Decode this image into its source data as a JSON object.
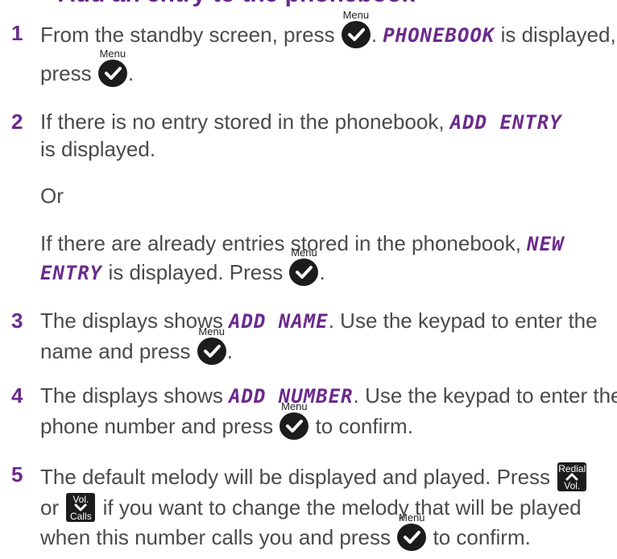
{
  "heading": "Add an entry to the phonebook",
  "menu_key_label": "Menu",
  "redial_key": {
    "top": "Redial",
    "bottom": "Vol."
  },
  "down_key": {
    "top": "Vol.",
    "bottom": "Calls"
  },
  "steps": [
    {
      "number": "1",
      "text_a": "From the standby screen, press",
      "lcd_a": "PHONEBOOK",
      "text_b": "is displayed,",
      "text_c": "press",
      "text_d": "."
    },
    {
      "number": "2",
      "text_a": "If there is no entry stored in the phonebook,",
      "lcd_a": "ADD ENTRY",
      "text_b": "is displayed.",
      "or": "Or",
      "text_c": "If there are already entries stored in the phonebook,",
      "lcd_b": "NEW",
      "lcd_c": "ENTRY",
      "text_d": "is displayed. Press",
      "text_e": "."
    },
    {
      "number": "3",
      "text_a": "The displays shows",
      "lcd_a": "ADD NAME",
      "text_b": ". Use the keypad to enter the",
      "text_c": "name and press",
      "text_d": "."
    },
    {
      "number": "4",
      "text_a": "The displays shows",
      "lcd_a": "ADD NUMBER",
      "text_b": ". Use the keypad to enter the",
      "text_c": "phone number and press",
      "text_d": "to confirm."
    },
    {
      "number": "5",
      "text_a": "The default melody will be displayed and played. Press",
      "text_b": "or",
      "text_c": "if you want to change the melody that will be played",
      "text_d": "when this number calls you and press",
      "text_e": "to confirm."
    }
  ]
}
